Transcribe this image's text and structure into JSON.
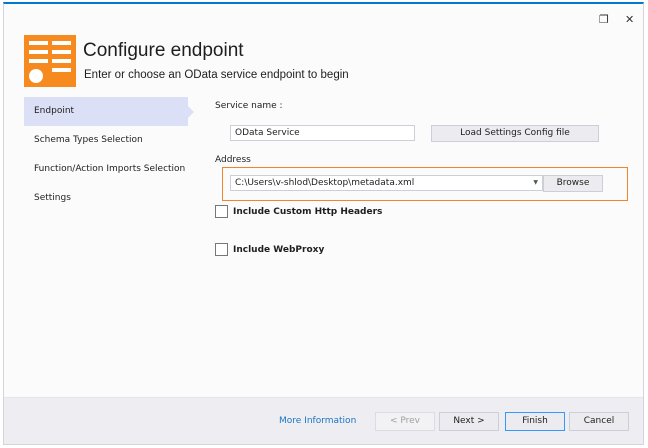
{
  "window": {
    "restore_icon": "restore-icon",
    "close_icon": "close-icon"
  },
  "header": {
    "title": "Configure endpoint",
    "subtitle": "Enter or choose an OData service endpoint to begin"
  },
  "nav": {
    "items": [
      {
        "label": "Endpoint",
        "active": true
      },
      {
        "label": "Schema Types Selection"
      },
      {
        "label": "Function/Action Imports Selection"
      },
      {
        "label": "Settings"
      }
    ]
  },
  "form": {
    "service_name_label": "Service name :",
    "service_name_value": "OData Service",
    "load_config_label": "Load Settings Config file",
    "address_label": "Address",
    "address_value": "C:\\Users\\v-shlod\\Desktop\\metadata.xml",
    "browse_label": "Browse",
    "custom_headers_label": "Include Custom Http Headers",
    "custom_headers_checked": false,
    "webproxy_label": "Include WebProxy",
    "webproxy_checked": false
  },
  "footer": {
    "more_info": "More Information",
    "prev": "< Prev",
    "next": "Next >",
    "finish": "Finish",
    "cancel": "Cancel"
  },
  "colors": {
    "accent": "#f68a1e",
    "title_bar": "#007acc",
    "link": "#1a74c4"
  }
}
